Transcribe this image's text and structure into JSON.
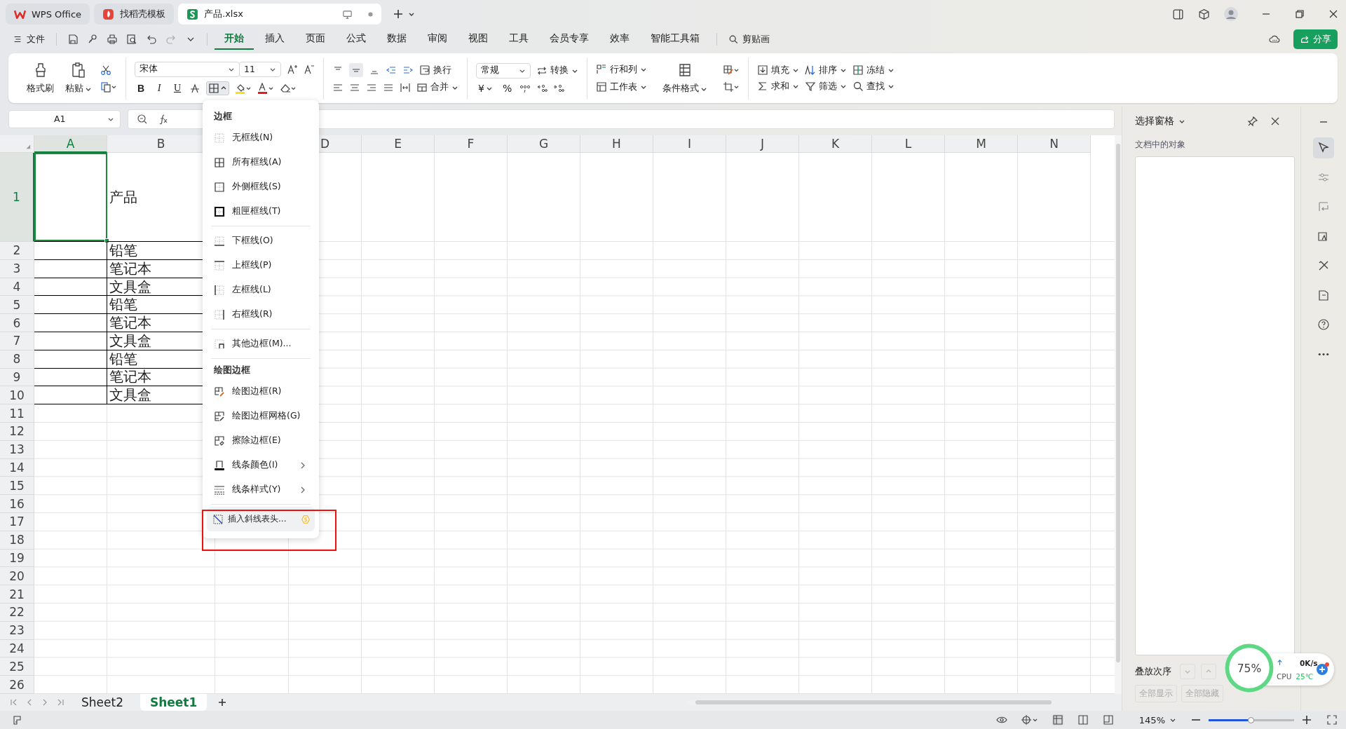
{
  "tabs": [
    {
      "label": "WPS Office",
      "kind": "wps",
      "selected": false
    },
    {
      "label": "找稻壳模板",
      "kind": "docer",
      "selected": false
    },
    {
      "label": "产品.xlsx",
      "kind": "sheet",
      "selected": true
    }
  ],
  "file_menu": "文件",
  "ribbon_tabs": [
    {
      "label": "开始",
      "selected": true
    },
    {
      "label": "插入",
      "selected": false
    },
    {
      "label": "页面",
      "selected": false
    },
    {
      "label": "公式",
      "selected": false
    },
    {
      "label": "数据",
      "selected": false
    },
    {
      "label": "审阅",
      "selected": false
    },
    {
      "label": "视图",
      "selected": false
    },
    {
      "label": "工具",
      "selected": false
    },
    {
      "label": "会员专享",
      "selected": false
    },
    {
      "label": "效率",
      "selected": false
    },
    {
      "label": "智能工具箱",
      "selected": false
    }
  ],
  "search_label": "剪贴画",
  "share_button": "分享",
  "ribbon": {
    "format_painter": "格式刷",
    "paste": "粘贴",
    "font_name": "宋体",
    "font_size": "11",
    "font_styles": [
      "B",
      "I",
      "U"
    ],
    "wrap": "换行",
    "merge": "合并",
    "number_format": "常规",
    "convert": "转换",
    "currency_symbol": "¥",
    "percent_symbol": "%",
    "rows_cols": "行和列",
    "worksheet": "工作表",
    "conditional_format": "条件格式",
    "fill": "填充",
    "sort": "排序",
    "freeze": "冻结",
    "sum": "求和",
    "filter": "筛选",
    "find": "查找"
  },
  "name_box": "A1",
  "columns": [
    {
      "label": "A"
    },
    {
      "label": "B"
    },
    {
      "label": "D"
    },
    {
      "label": "E"
    },
    {
      "label": "F"
    },
    {
      "label": "G"
    },
    {
      "label": "H"
    },
    {
      "label": "I"
    },
    {
      "label": "J"
    },
    {
      "label": "K"
    },
    {
      "label": "L"
    },
    {
      "label": "M"
    },
    {
      "label": "N"
    }
  ],
  "rows": [
    {
      "label": "1",
      "cell_b": "产品",
      "bordered": false,
      "a_selected": true
    },
    {
      "label": "2",
      "cell_b": "铅笔",
      "bordered": true,
      "a_selected": false
    },
    {
      "label": "3",
      "cell_b": "笔记本",
      "bordered": true,
      "a_selected": false
    },
    {
      "label": "4",
      "cell_b": "文具盒",
      "bordered": true,
      "a_selected": false
    },
    {
      "label": "5",
      "cell_b": "铅笔",
      "bordered": true,
      "a_selected": false
    },
    {
      "label": "6",
      "cell_b": "笔记本",
      "bordered": true,
      "a_selected": false
    },
    {
      "label": "7",
      "cell_b": "文具盒",
      "bordered": true,
      "a_selected": false
    },
    {
      "label": "8",
      "cell_b": "铅笔",
      "bordered": true,
      "a_selected": false
    },
    {
      "label": "9",
      "cell_b": "笔记本",
      "bordered": true,
      "a_selected": false
    },
    {
      "label": "10",
      "cell_b": "文具盒",
      "bordered": true,
      "a_selected": false
    },
    {
      "label": "11",
      "bordered": false,
      "a_selected": false
    },
    {
      "label": "12",
      "bordered": false,
      "a_selected": false
    },
    {
      "label": "13",
      "bordered": false,
      "a_selected": false
    },
    {
      "label": "14",
      "bordered": false,
      "a_selected": false
    },
    {
      "label": "15",
      "bordered": false,
      "a_selected": false
    },
    {
      "label": "16",
      "bordered": false,
      "a_selected": false
    },
    {
      "label": "17",
      "bordered": false,
      "a_selected": false
    },
    {
      "label": "18",
      "bordered": false,
      "a_selected": false
    },
    {
      "label": "19",
      "bordered": false,
      "a_selected": false
    },
    {
      "label": "20",
      "bordered": false,
      "a_selected": false
    },
    {
      "label": "21",
      "bordered": false,
      "a_selected": false
    },
    {
      "label": "22",
      "bordered": false,
      "a_selected": false
    },
    {
      "label": "23",
      "bordered": false,
      "a_selected": false
    },
    {
      "label": "24",
      "bordered": false,
      "a_selected": false
    },
    {
      "label": "25",
      "bordered": false,
      "a_selected": false
    },
    {
      "label": "26",
      "bordered": false,
      "a_selected": false
    }
  ],
  "border_menu": {
    "groups": [
      {
        "heading": "边框",
        "items": [
          {
            "label": "无框线(N)",
            "kind": "none",
            "submenu": false,
            "premium": false,
            "selected": false
          },
          {
            "label": "所有框线(A)",
            "kind": "all",
            "submenu": false,
            "premium": false,
            "selected": false
          },
          {
            "label": "外侧框线(S)",
            "kind": "outside",
            "submenu": false,
            "premium": false,
            "selected": false
          },
          {
            "label": "粗匣框线(T)",
            "kind": "thick",
            "submenu": false,
            "premium": false,
            "selected": false
          }
        ]
      },
      {
        "items": [
          {
            "label": "下框线(O)",
            "kind": "bottom",
            "submenu": false,
            "premium": false,
            "selected": false
          },
          {
            "label": "上框线(P)",
            "kind": "top",
            "submenu": false,
            "premium": false,
            "selected": false
          },
          {
            "label": "左框线(L)",
            "kind": "left",
            "submenu": false,
            "premium": false,
            "selected": false
          },
          {
            "label": "右框线(R)",
            "kind": "right",
            "submenu": false,
            "premium": false,
            "selected": false
          }
        ]
      },
      {
        "items": [
          {
            "label": "其他边框(M)...",
            "kind": "more",
            "submenu": false,
            "premium": false,
            "selected": false
          }
        ]
      },
      {
        "heading": "绘图边框",
        "items": [
          {
            "label": "绘图边框(R)",
            "kind": "draw",
            "submenu": false,
            "premium": false,
            "selected": false
          },
          {
            "label": "绘图边框网格(G)",
            "kind": "draw-grid",
            "submenu": false,
            "premium": false,
            "selected": false
          },
          {
            "label": "擦除边框(E)",
            "kind": "erase",
            "submenu": false,
            "premium": false,
            "selected": false
          },
          {
            "label": "线条颜色(I)",
            "kind": "line-color",
            "submenu": true,
            "premium": false,
            "selected": false
          },
          {
            "label": "线条样式(Y)",
            "kind": "line-style",
            "submenu": true,
            "premium": false,
            "selected": false
          }
        ]
      },
      {
        "items": [
          {
            "label": "插入斜线表头...",
            "kind": "diagonal",
            "submenu": false,
            "premium": true,
            "selected": true
          }
        ]
      }
    ]
  },
  "selection_pane": {
    "title": "选择窗格",
    "subtitle": "文档中的对象",
    "order_label": "叠放次序",
    "buttons": [
      "全部显示",
      "全部隐藏"
    ]
  },
  "side_tools": [
    {
      "kind": "cursor",
      "selected": true
    },
    {
      "kind": "sliders",
      "selected": false
    },
    {
      "kind": "crop",
      "selected": false
    },
    {
      "kind": "image",
      "selected": false
    },
    {
      "kind": "tools",
      "selected": false
    },
    {
      "kind": "book",
      "selected": false
    },
    {
      "kind": "help",
      "selected": false
    },
    {
      "kind": "more",
      "selected": false
    }
  ],
  "sheets": [
    {
      "label": "Sheet2",
      "selected": false
    },
    {
      "label": "Sheet1",
      "selected": true
    }
  ],
  "status_bar": {
    "zoom": "145%",
    "zoom_slider": {
      "level": 0.5
    }
  },
  "monitor_widget": {
    "percent": "75%",
    "speed": "0K/s",
    "cpu_label": "CPU",
    "temperature": "25℃"
  }
}
